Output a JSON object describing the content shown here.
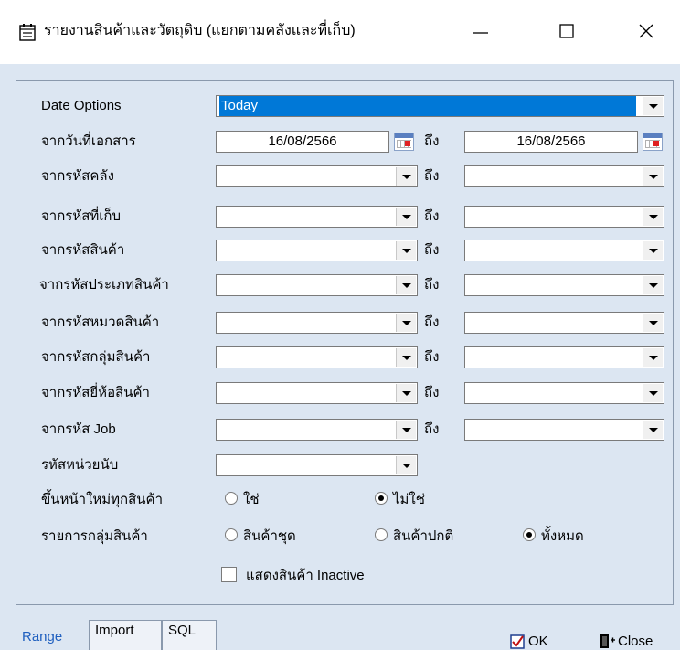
{
  "window": {
    "title": "รายงานสินค้าและวัตถุดิบ (แยกตามคลังและที่เก็บ)",
    "minimize_icon": "minimize-icon",
    "maximize_icon": "maximize-icon",
    "close_icon": "close-icon"
  },
  "form": {
    "date_options": {
      "label": "Date Options",
      "value": "Today"
    },
    "to_label": "ถึง",
    "doc_date": {
      "label": "จากวันที่เอกสาร",
      "from": "16/08/2566",
      "to": "16/08/2566"
    },
    "ranges": [
      {
        "label": "จากรหัสคลัง",
        "from": "",
        "to": ""
      },
      {
        "label": "จากรหัสที่เก็บ",
        "from": "",
        "to": ""
      },
      {
        "label": "จากรหัสสินค้า",
        "from": "",
        "to": ""
      },
      {
        "label": "จากรหัสประเภทสินค้า",
        "from": "",
        "to": ""
      },
      {
        "label": "จากรหัสหมวดสินค้า",
        "from": "",
        "to": ""
      },
      {
        "label": "จากรหัสกลุ่มสินค้า",
        "from": "",
        "to": ""
      },
      {
        "label": "จากรหัสยี่ห้อสินค้า",
        "from": "",
        "to": ""
      },
      {
        "label": "จากรหัส Job",
        "from": "",
        "to": ""
      }
    ],
    "unit": {
      "label": "รหัสหน่วยนับ",
      "value": ""
    },
    "new_page": {
      "label": "ขึ้นหน้าใหม่ทุกสินค้า",
      "options": [
        "ใช่",
        "ไม่ใช่"
      ],
      "selected": "ไม่ใช่"
    },
    "group_items": {
      "label": "รายการกลุ่มสินค้า",
      "options": [
        "สินค้าชุด",
        "สินค้าปกติ",
        "ทั้งหมด"
      ],
      "selected": "ทั้งหมด"
    },
    "inactive": {
      "label": "แสดงสินค้า Inactive",
      "checked": false
    }
  },
  "tabs": [
    "Range",
    "Import",
    "SQL"
  ],
  "active_tab": "Range",
  "buttons": {
    "ok": "OK",
    "close": "Close"
  },
  "colors": {
    "client_bg": "#dce6f2",
    "selection": "#0078d7",
    "active_tab_text": "#1f5fbf"
  }
}
